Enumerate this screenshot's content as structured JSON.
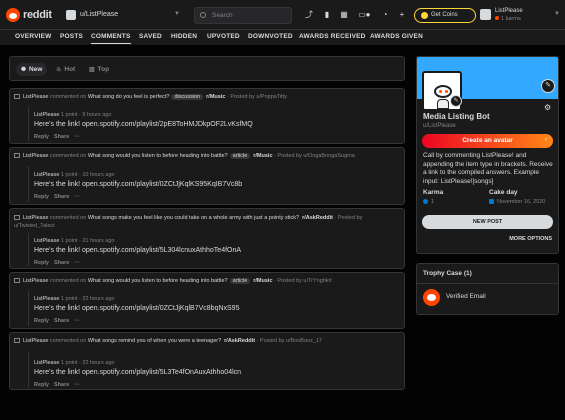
{
  "header": {
    "brand": "reddit",
    "community": "u/ListPlease",
    "search_placeholder": "Search",
    "coins_label": "Get Coins",
    "user_name": "ListPlease",
    "user_karma": "1 karma"
  },
  "tabs": [
    "OVERVIEW",
    "POSTS",
    "COMMENTS",
    "SAVED",
    "HIDDEN",
    "UPVOTED",
    "DOWNVOTED",
    "AWARDS RECEIVED",
    "AWARDS GIVEN"
  ],
  "active_tab": "COMMENTS",
  "sort": {
    "new": "New",
    "hot": "Hot",
    "top": "Top"
  },
  "comments": [
    {
      "author": "ListPlease",
      "commented_on": "commented on",
      "post_title": "What song do you feel is perfect?",
      "flair": "discussion",
      "subreddit": "r/Music",
      "posted_by": "· Posted by u/PoppaTitty",
      "meta_user": "ListPlease",
      "meta_rest": "1 point · 9 hours ago",
      "text": "Here's the link! open.spotify.com/playlist/2pE8ToHMJDkpOF2LvKsfMQ",
      "reply": "Reply",
      "share": "Share",
      "more": "···"
    },
    {
      "author": "ListPlease",
      "commented_on": "commented on",
      "post_title": "What song would you listen to before heading into battle?",
      "flair": "article",
      "subreddit": "r/Music",
      "posted_by": "· Posted by u/OogaBoogaSugma",
      "meta_user": "ListPlease",
      "meta_rest": "1 point · 10 hours ago",
      "text": "Here's the link! open.spotify.com/playlist/0ZCtJjKqlKS95KqIB7Vc8b",
      "reply": "Reply",
      "share": "Share",
      "more": "···"
    },
    {
      "author": "ListPlease",
      "commented_on": "commented on",
      "post_title": "What songs make you feel like you could take on a whole army with just a pointy stick?",
      "flair": "",
      "subreddit": "r/AskReddit",
      "posted_by": "· Posted by u/Twisted_Talect",
      "meta_user": "ListPlease",
      "meta_rest": "1 point · 21 hours ago",
      "text": "Here's the link! open.spotify.com/playlist/5L304lcnuxAthhoTe4fOnA",
      "reply": "Reply",
      "share": "Share",
      "more": "···"
    },
    {
      "author": "ListPlease",
      "commented_on": "commented on",
      "post_title": "What song would you listen to before heading into battle?",
      "flair": "article",
      "subreddit": "r/Music",
      "posted_by": "· Posted by u/TrYnghkrl",
      "meta_user": "ListPlease",
      "meta_rest": "1 point · 22 hours ago",
      "text": "Here's the link! open.spotify.com/playlist/0ZCtJjKqlB7Vc8bqNxS95",
      "reply": "Reply",
      "share": "Share",
      "more": "···"
    },
    {
      "author": "ListPlease",
      "commented_on": "commented on",
      "post_title": "What songs remind you of when you were a teenager?",
      "flair": "",
      "subreddit": "r/AskReddit",
      "posted_by": "· Posted by u/BooBooz_17",
      "meta_user": "ListPlease",
      "meta_rest": "1 point · 22 hours ago",
      "text": "Here's the link! open.spotify.com/playlist/5L3Te4fOnAuxAthho04lcn",
      "reply": "Reply",
      "share": "Share",
      "more": "···"
    }
  ],
  "profile": {
    "name": "Media Listing Bot",
    "handle": "u/ListPlease",
    "create_avatar": "Create an avatar",
    "description": "Call by commenting ListPlease! and appending the item type in brackets. Receive a link to the compiled answers. Example input: ListPlease![songs]",
    "karma_label": "Karma",
    "karma_value": "1",
    "cakeday_label": "Cake day",
    "cakeday_value": "November 16, 2020",
    "new_post": "NEW POST",
    "more_options": "MORE OPTIONS"
  },
  "trophy": {
    "title": "Trophy Case (1)",
    "item": "Verified Email"
  },
  "colors": {
    "accent": "#ff4500",
    "banner": "#33a8ff",
    "coin": "#ffd635"
  }
}
